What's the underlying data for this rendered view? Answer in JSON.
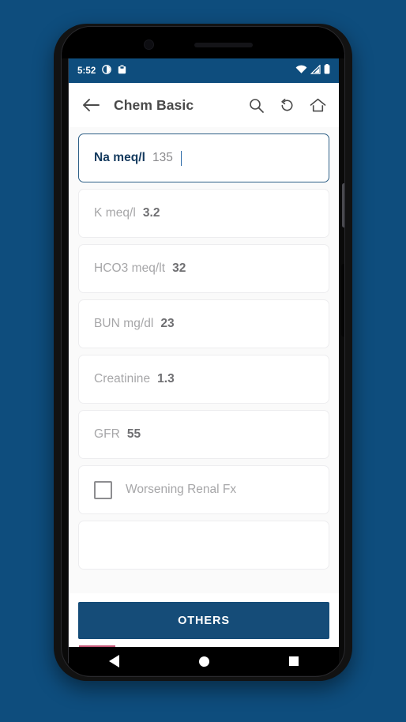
{
  "status_bar": {
    "time": "5:52",
    "left_icons": [
      "do-not-disturb-icon",
      "screenshot-icon"
    ],
    "right_icons": [
      "wifi-icon",
      "cellular-signal-icon",
      "battery-icon"
    ]
  },
  "app_bar": {
    "back_label": "back-arrow",
    "title": "Chem Basic",
    "actions": [
      {
        "name": "search-icon",
        "label": "Search"
      },
      {
        "name": "reset-icon",
        "label": "Reset"
      },
      {
        "name": "home-icon",
        "label": "Home"
      }
    ]
  },
  "fields": [
    {
      "label": "Na meq/l",
      "value": "135",
      "focused": true
    },
    {
      "label": "K meq/l",
      "value": "3.2",
      "focused": false
    },
    {
      "label": "HCO3 meq/lt",
      "value": "32",
      "focused": false
    },
    {
      "label": "BUN mg/dl",
      "value": "23",
      "focused": false
    },
    {
      "label": "Creatinine",
      "value": "1.3",
      "focused": false
    },
    {
      "label": "GFR",
      "value": "55",
      "focused": false
    }
  ],
  "checkbox_row": {
    "label": "Worsening Renal Fx",
    "checked": false
  },
  "bottom_action": {
    "label": "OTHERS"
  },
  "nav_bar": {
    "back": "back-triangle-icon",
    "home": "home-circle-icon",
    "recents": "recents-square-icon"
  },
  "colors": {
    "brand": "#0e4d7d",
    "button": "#154c78",
    "focus_border": "#2d5f86",
    "focus_label": "#143a5e",
    "muted_text": "#a6a6a8",
    "page_bg": "#fafafa"
  }
}
